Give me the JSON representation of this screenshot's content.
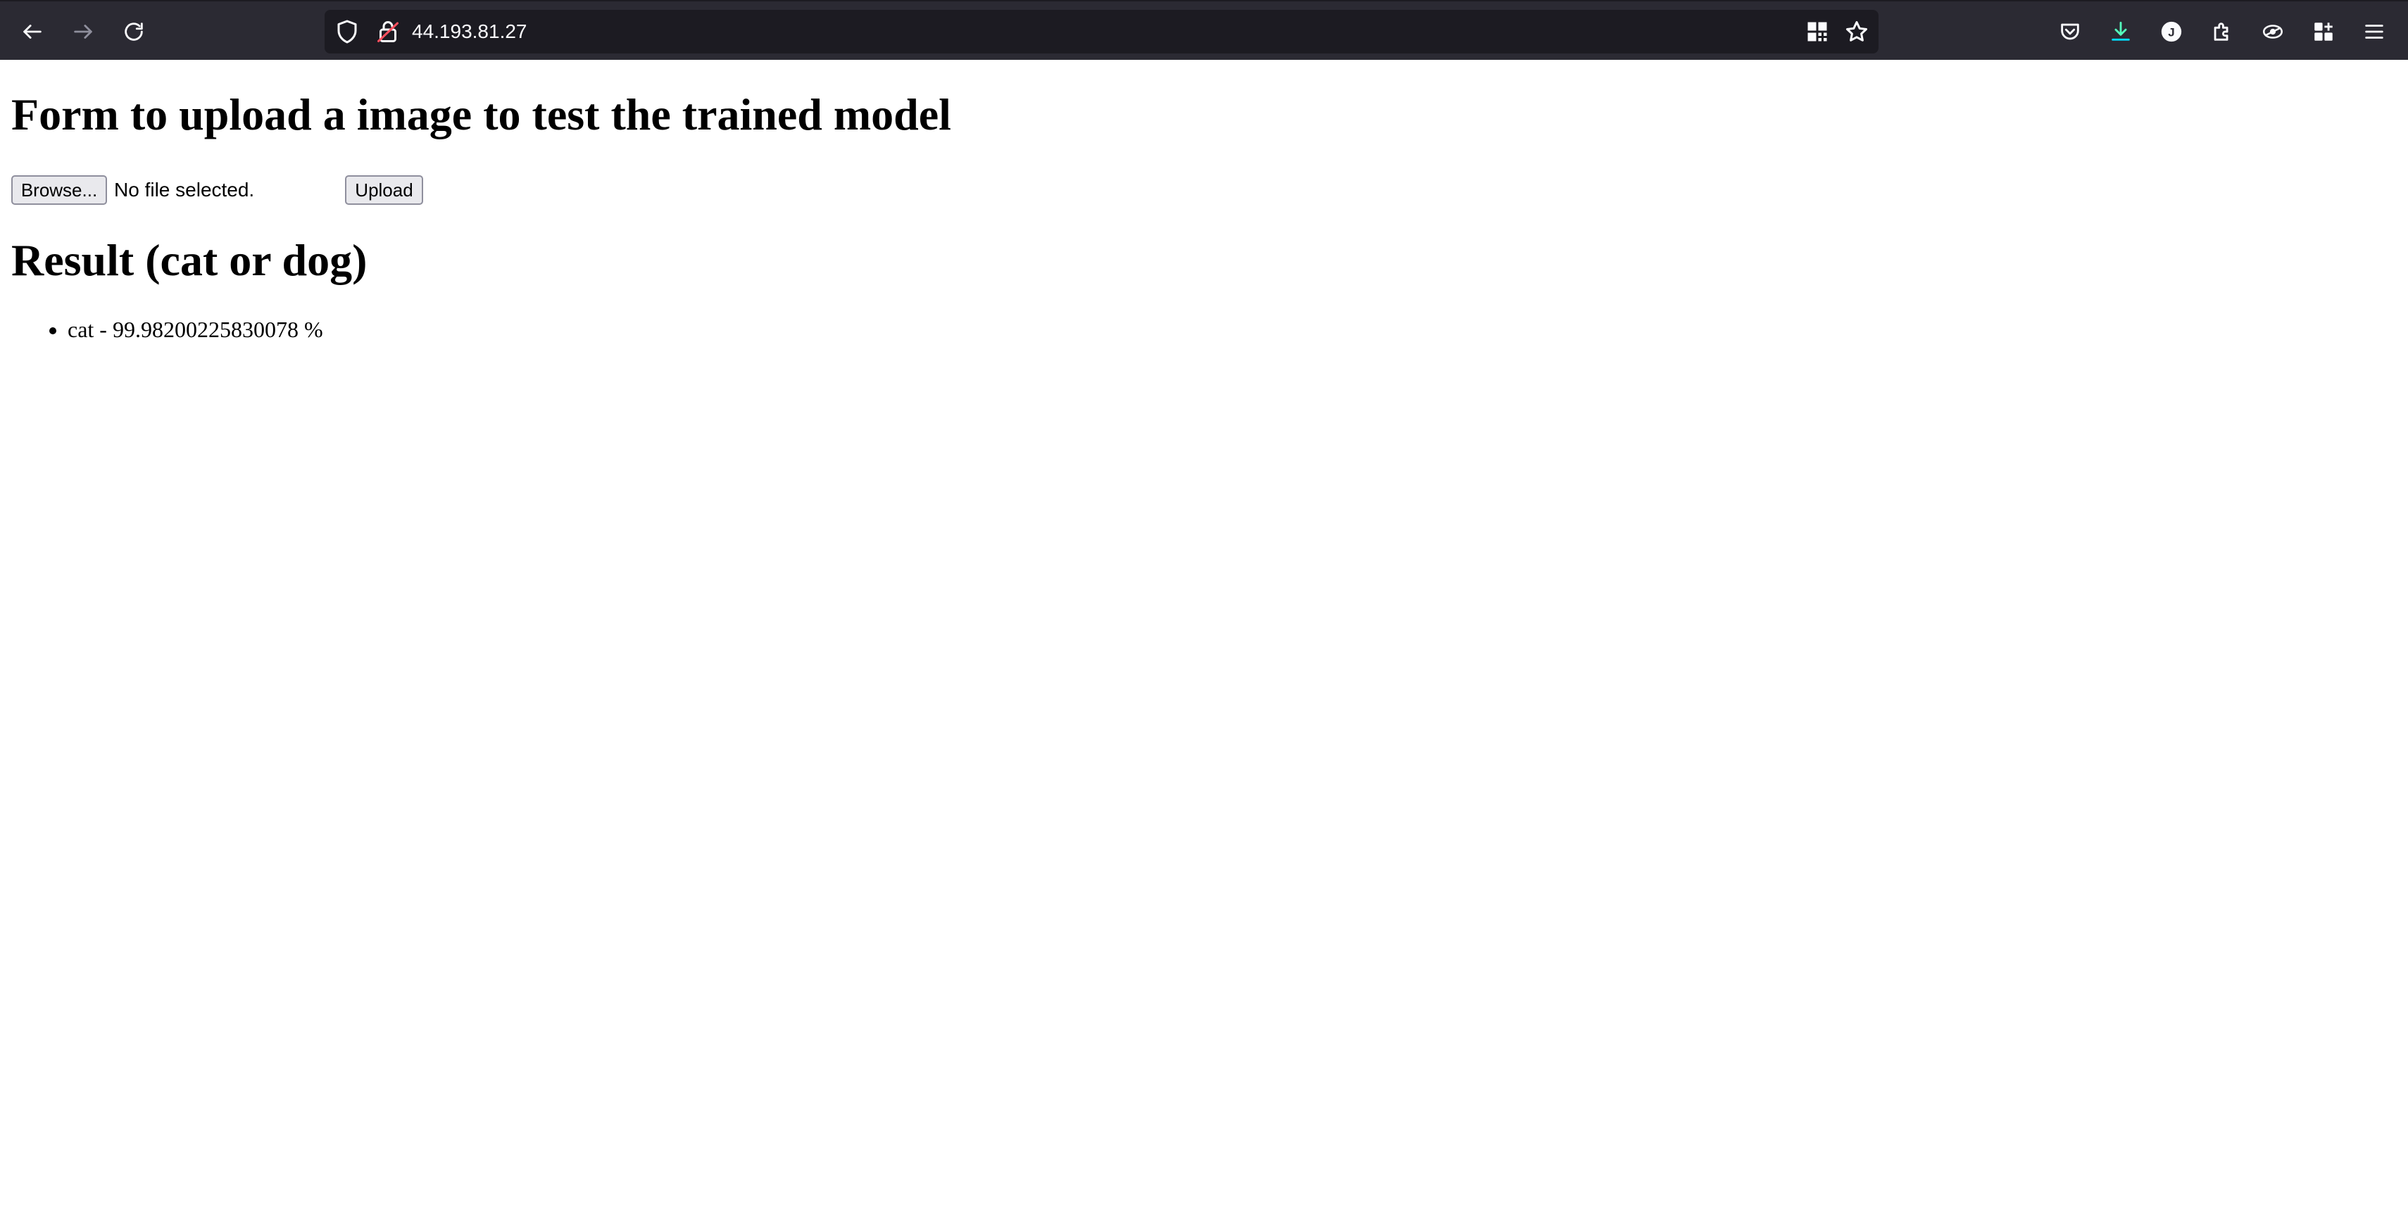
{
  "browser": {
    "url": "44.193.81.27",
    "icons": {
      "back": "arrow-left-icon",
      "forward": "arrow-right-icon",
      "reload": "reload-icon",
      "tracking": "shield-icon",
      "connection": "insecure-lock-icon",
      "qr": "qr-code-icon",
      "bookmark": "star-icon",
      "pocket": "pocket-icon",
      "downloads": "download-icon",
      "account": "account-icon",
      "extensions": "puzzle-icon",
      "extension": "extension-icon",
      "apps": "apps-grid-icon",
      "menu": "hamburger-menu-icon"
    },
    "colors": {
      "toolbar": "#2b2a33",
      "urlbar": "#1c1b22",
      "icon": "#fbfbfe",
      "download_accent": "#54ffbd"
    }
  },
  "page": {
    "form_heading": "Form to upload a image to test the trained model",
    "file_input": {
      "button_label": "Browse...",
      "status": "No file selected."
    },
    "upload_label": "Upload",
    "result_heading": "Result (cat or dog)",
    "results": [
      "cat - 99.98200225830078 %"
    ]
  }
}
